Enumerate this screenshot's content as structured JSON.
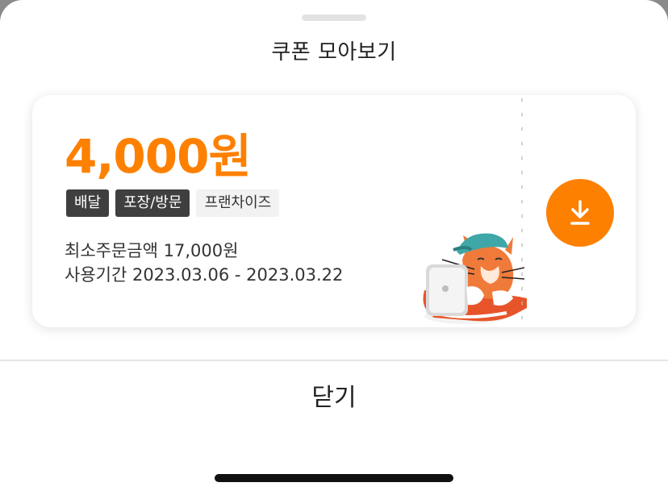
{
  "sheet": {
    "title": "쿠폰 모아보기",
    "close_label": "닫기"
  },
  "coupon": {
    "amount": "4,000원",
    "tags": [
      {
        "label": "배달",
        "style": "dark"
      },
      {
        "label": "포장/방문",
        "style": "dark"
      },
      {
        "label": "프랜차이즈",
        "style": "light"
      }
    ],
    "min_order": "최소주문금액 17,000원",
    "period": "사용기간 2023.03.06 - 2023.03.22",
    "download_icon": "download-icon",
    "mascot": "cat-mascot-illustration"
  },
  "colors": {
    "accent": "#fd8000",
    "tag_dark": "#3f3f3f",
    "tag_light": "#f2f2f2"
  }
}
